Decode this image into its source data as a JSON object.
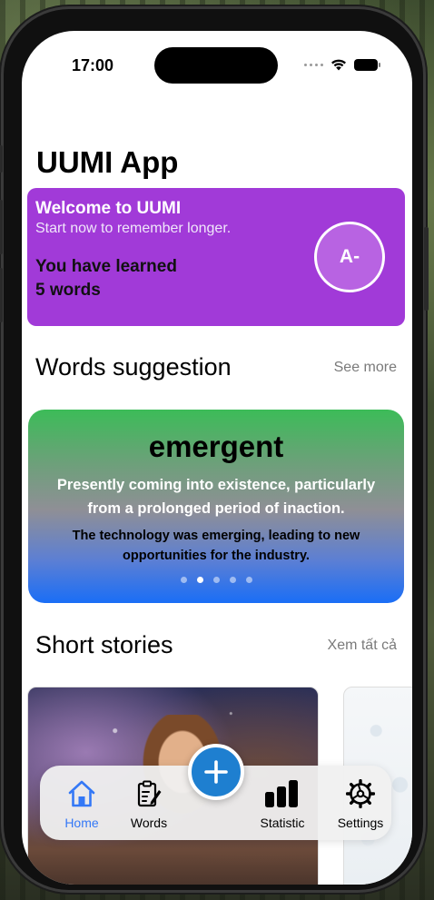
{
  "status_bar": {
    "time": "17:00"
  },
  "app": {
    "title": "UUMI App"
  },
  "welcome": {
    "title": "Welcome to UUMI",
    "subtitle": "Start now to remember longer.",
    "learned_line1": "You have learned",
    "learned_line2": "5 words",
    "grade": "A-",
    "color": "#a13ad8"
  },
  "words_section": {
    "title": "Words suggestion",
    "see_more": "See more",
    "card": {
      "word": "emergent",
      "definition": "Presently coming into existence, particularly from a prolonged period of inaction.",
      "example": "The technology was emerging, leading to new opportunities for the industry.",
      "page_count": 5,
      "active_page": 1
    }
  },
  "stories_section": {
    "title": "Short stories",
    "see_all": "Xem tất cả"
  },
  "tabbar": {
    "tabs": [
      {
        "label": "Home",
        "icon": "home-icon",
        "active": true
      },
      {
        "label": "Words",
        "icon": "clipboard-edit-icon",
        "active": false
      },
      {
        "label": "Statistic",
        "icon": "bar-chart-icon",
        "active": false
      },
      {
        "label": "Settings",
        "icon": "gear-icon",
        "active": false
      }
    ],
    "accent": "#3478f6",
    "fab_icon": "plus-icon",
    "fab_color": "#1e7fd0"
  }
}
